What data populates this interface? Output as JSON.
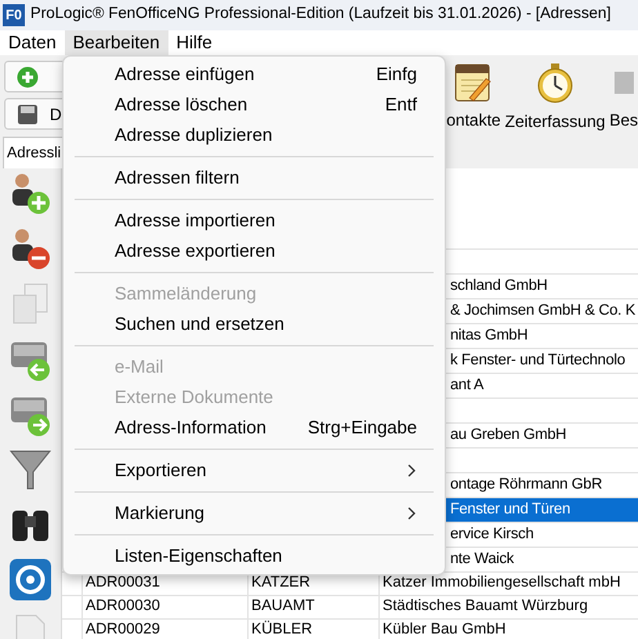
{
  "window": {
    "title": "ProLogic® FenOfficeNG Professional-Edition (Laufzeit bis 31.01.2026) - [Adressen]",
    "app_icon": "F0"
  },
  "menu_bar": [
    {
      "label": "Daten",
      "selected": false
    },
    {
      "label": "Bearbeiten",
      "selected": true
    },
    {
      "label": "Hilfe",
      "selected": false
    }
  ],
  "toolbar_left": [
    {
      "label": "D"
    }
  ],
  "toolbar_right": [
    {
      "label": "ontakte"
    },
    {
      "label": "Zeiterfassung"
    },
    {
      "label": "Bes"
    }
  ],
  "tab": {
    "label": "Adressli"
  },
  "context_menu": [
    {
      "kind": "item",
      "label": "Adresse einfügen",
      "shortcut": "Einfg",
      "disabled": false
    },
    {
      "kind": "item",
      "label": "Adresse löschen",
      "shortcut": "Entf",
      "disabled": false
    },
    {
      "kind": "item",
      "label": "Adresse duplizieren",
      "disabled": false
    },
    {
      "kind": "separator"
    },
    {
      "kind": "item",
      "label": "Adressen filtern",
      "disabled": false
    },
    {
      "kind": "separator"
    },
    {
      "kind": "item",
      "label": "Adresse importieren",
      "disabled": false
    },
    {
      "kind": "item",
      "label": "Adresse exportieren",
      "disabled": false
    },
    {
      "kind": "separator"
    },
    {
      "kind": "item",
      "label": "Sammeländerung",
      "disabled": true
    },
    {
      "kind": "item",
      "label": "Suchen und ersetzen",
      "disabled": false
    },
    {
      "kind": "separator"
    },
    {
      "kind": "item",
      "label": "e-Mail",
      "disabled": true
    },
    {
      "kind": "item",
      "label": "Externe Dokumente",
      "disabled": true
    },
    {
      "kind": "item",
      "label": "Adress-Information",
      "shortcut": "Strg+Eingabe",
      "disabled": false
    },
    {
      "kind": "separator"
    },
    {
      "kind": "submenu",
      "label": "Exportieren",
      "disabled": false
    },
    {
      "kind": "separator"
    },
    {
      "kind": "submenu",
      "label": "Markierung",
      "disabled": false
    },
    {
      "kind": "separator"
    },
    {
      "kind": "item",
      "label": "Listen-Eigenschaften",
      "disabled": false
    }
  ],
  "table": {
    "rows": [
      {
        "selected": false
      },
      {
        "selected": false
      },
      {
        "name": "schland GmbH",
        "selected": false
      },
      {
        "name": "& Jochimsen GmbH & Co. K",
        "selected": false
      },
      {
        "name": "nitas GmbH",
        "selected": false
      },
      {
        "name": "k Fenster- und Türtechnolo",
        "selected": false
      },
      {
        "name": "ant A",
        "selected": false
      },
      {
        "selected": false
      },
      {
        "name": "au Greben GmbH",
        "selected": false
      },
      {
        "selected": false
      },
      {
        "name": "ontage Röhrmann GbR",
        "selected": false
      },
      {
        "name": "Fenster und Türen",
        "selected": true
      },
      {
        "name": "ervice Kirsch",
        "selected": false
      },
      {
        "name": "nte Waick",
        "selected": false
      },
      {
        "id": "ADR00031",
        "match": "KATZER",
        "name": "Katzer Immobiliengesellschaft mbH",
        "selected": false
      },
      {
        "id": "ADR00030",
        "match": "BAUAMT",
        "name": "Städtisches Bauamt Würzburg",
        "selected": false
      },
      {
        "id": "ADR00029",
        "match": "KÜBLER",
        "name": "Kübler Bau GmbH",
        "selected": false
      }
    ]
  }
}
